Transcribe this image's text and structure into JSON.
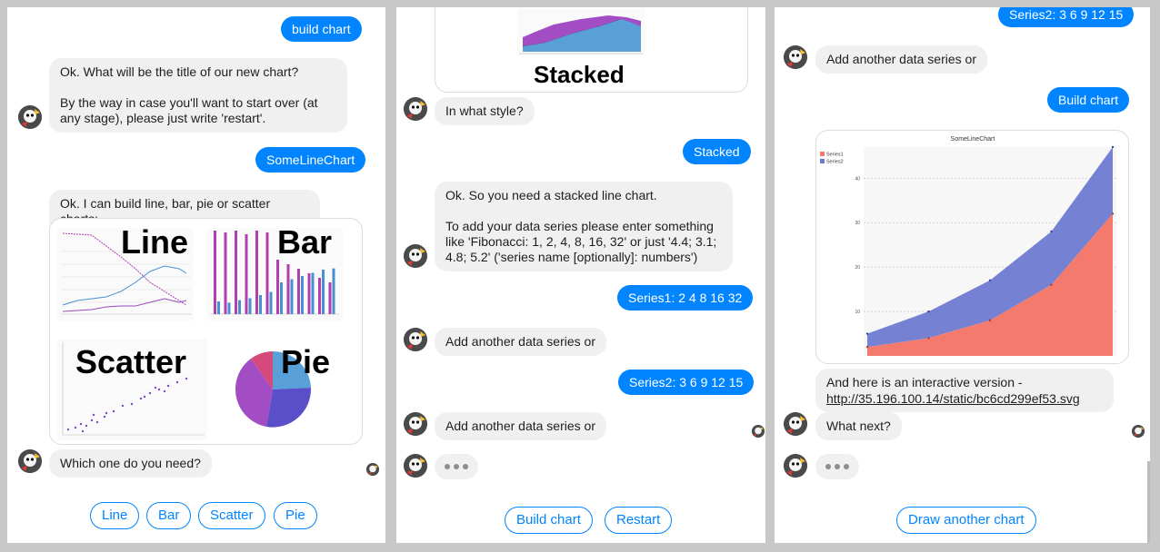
{
  "panel1": {
    "msg_build_chart": "build chart",
    "msg_title_question": "Ok. What will be the title of our new chart?\n\nBy the way in case you'll want to start over (at any stage), please just write 'restart'.",
    "msg_title_answer": "SomeLineChart",
    "msg_chart_types": "Ok. I can build line, bar, pie or scatter charts:",
    "thumb_labels": {
      "line": "Line",
      "bar": "Bar",
      "scatter": "Scatter",
      "pie": "Pie"
    },
    "msg_which": "Which one do you need?",
    "quick_replies": [
      "Line",
      "Bar",
      "Scatter",
      "Pie"
    ]
  },
  "panel2": {
    "stacked_label": "Stacked",
    "msg_style_question": "In what style?",
    "msg_style_answer": "Stacked",
    "msg_stacked_info": "Ok. So you need a stacked line chart.\n\nTo add your data series please enter something like 'Fibonacci: 1, 2, 4, 8, 16, 32' or just '4.4; 3.1; 4.8; 5.2' ('series name [optionally]: numbers')",
    "msg_series1": "Series1: 2 4 8 16 32",
    "msg_add_another_1": "Add another data series or",
    "msg_series2": "Series2: 3 6 9 12 15",
    "msg_add_another_2": "Add another data series or",
    "quick_replies": [
      "Build chart",
      "Restart"
    ]
  },
  "panel3": {
    "msg_series2": "Series2: 3 6 9 12 15",
    "msg_add_another": "Add another data series or",
    "msg_build_chart": "Build chart",
    "msg_interactive": "And here is an interactive version -",
    "link": "http://35.196.100.14/static/bc6cd299ef53.svg",
    "msg_what_next": "What next?",
    "quick_replies": [
      "Draw another chart"
    ]
  },
  "colors": {
    "user_bubble": "#0084ff",
    "bot_bubble": "#f1f0f0",
    "series1": "#f47a6e",
    "series2": "#6e7ad0"
  },
  "chart_data": {
    "type": "area",
    "title": "SomeLineChart",
    "stacked": true,
    "x": [
      1,
      2,
      3,
      4,
      5
    ],
    "series": [
      {
        "name": "Series1",
        "values": [
          2,
          4,
          8,
          16,
          32
        ]
      },
      {
        "name": "Series2",
        "values": [
          3,
          6,
          9,
          12,
          15
        ]
      }
    ],
    "y_ticks": [
      10,
      20,
      30,
      40
    ],
    "ylim": [
      0,
      47
    ],
    "legend": "top-left",
    "grid": true
  }
}
